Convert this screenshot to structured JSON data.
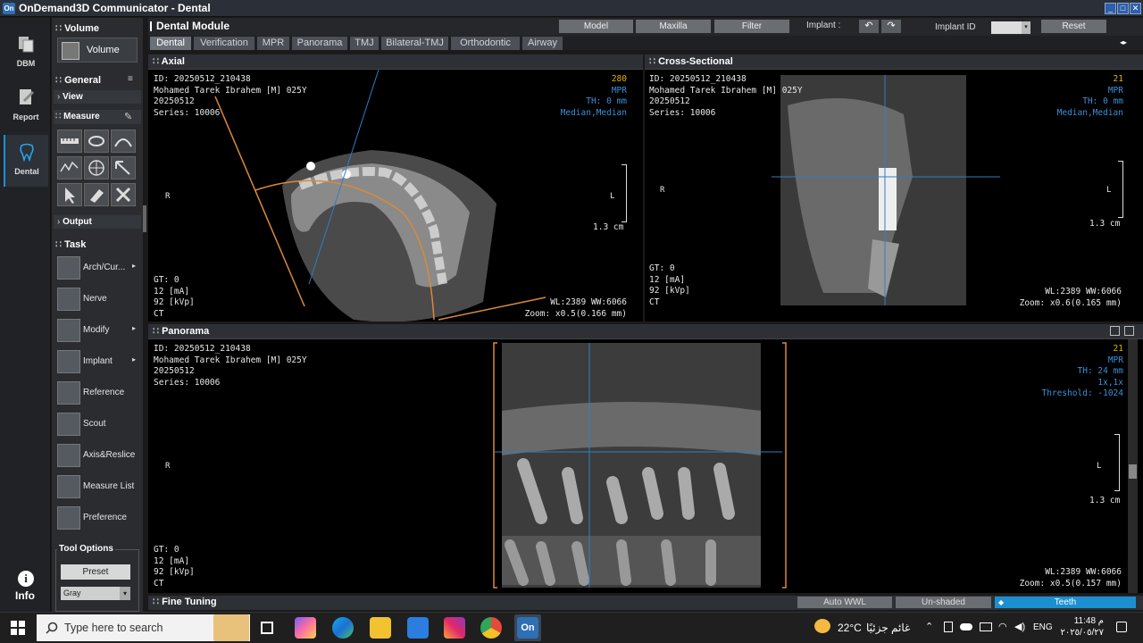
{
  "app": {
    "title": "OnDemand3D Communicator - Dental",
    "logo": "On",
    "win_buttons": [
      "_",
      "□",
      "✕"
    ]
  },
  "rail": {
    "items": [
      {
        "label": "DBM"
      },
      {
        "label": "Report"
      },
      {
        "label": "Dental"
      }
    ],
    "info": "Info"
  },
  "panel": {
    "volume_header": "Volume",
    "volume_button": "Volume",
    "general_header": "General",
    "view_label": "View",
    "measure_label": "Measure",
    "output_label": "Output",
    "task_header": "Task",
    "tasks": [
      {
        "label": "Arch/Cur...",
        "arrow": "▸"
      },
      {
        "label": "Nerve",
        "arrow": ""
      },
      {
        "label": "Modify",
        "arrow": "▸"
      },
      {
        "label": "Implant",
        "arrow": "▸"
      },
      {
        "label": "Reference",
        "arrow": ""
      },
      {
        "label": "Scout",
        "arrow": ""
      },
      {
        "label": "Axis&Reslice",
        "arrow": ""
      },
      {
        "label": "Measure List",
        "arrow": ""
      },
      {
        "label": "Preference",
        "arrow": ""
      }
    ],
    "tool_options": "Tool Options",
    "preset": "Preset",
    "gray": "Gray"
  },
  "module": {
    "title": "Dental Module",
    "buttons": {
      "model": "Model",
      "maxilla": "Maxilla",
      "filter": "Filter"
    },
    "implant_label": "Implant :",
    "implant_id_label": "Implant ID",
    "reset": "Reset",
    "tabs": [
      "Dental",
      "Verification",
      "MPR",
      "Panorama",
      "TMJ",
      "Bilateral-TMJ",
      "Orthodontic",
      "Airway"
    ],
    "active_tab": "Dental"
  },
  "patient": {
    "id": "ID: 20250512_210438",
    "name": "Mohamed Tarek Ibrahem [M] 025Y",
    "date": "20250512",
    "series": "Series: 10006"
  },
  "acq": {
    "gt": "GT: 0",
    "ma": "12 [mA]",
    "kvp": "92 [kVp]",
    "modality": "CT"
  },
  "axial": {
    "title": "Axial",
    "slice": "280",
    "mode": "MPR",
    "th": "TH: 0 mm",
    "filter": "Median,Median",
    "wlww": "WL:2389 WW:6066",
    "zoom": "Zoom: x0.5(0.166 mm)",
    "scale": "1.3 cm",
    "left": "R",
    "right": "L"
  },
  "cross": {
    "title": "Cross-Sectional",
    "slice": "21",
    "mode": "MPR",
    "th": "TH: 0 mm",
    "filter": "Median,Median",
    "wlww": "WL:2389 WW:6066",
    "zoom": "Zoom: x0.6(0.165 mm)",
    "scale": "1.3 cm",
    "left": "R",
    "right": "L"
  },
  "pano": {
    "title": "Panorama",
    "slice": "21",
    "mode": "MPR",
    "th": "TH: 24 mm",
    "scale_label": "1x,1x",
    "threshold": "Threshold: -1024",
    "wlww": "WL:2389 WW:6066",
    "zoom": "Zoom: x0.5(0.157 mm)",
    "scale": "1.3 cm",
    "left": "R",
    "right": "L"
  },
  "fine": {
    "title": "Fine Tuning",
    "auto_wwl": "Auto WWL",
    "unshaded": "Un-shaded",
    "teeth": "Teeth"
  },
  "taskbar": {
    "search_placeholder": "Type here to search",
    "weather": "22°C",
    "weather_text": "غائم جزئيًا",
    "lang": "ENG",
    "time": "11:48 م",
    "date": "٢٠٢٥/٠٥/٢٧"
  },
  "colors": {
    "accent": "#1b8fd0",
    "orange": "#d98a3a",
    "crosshair": "#2f7ec4",
    "annotation_blue": "#3b8fd8",
    "yellow": "#e0b400"
  }
}
